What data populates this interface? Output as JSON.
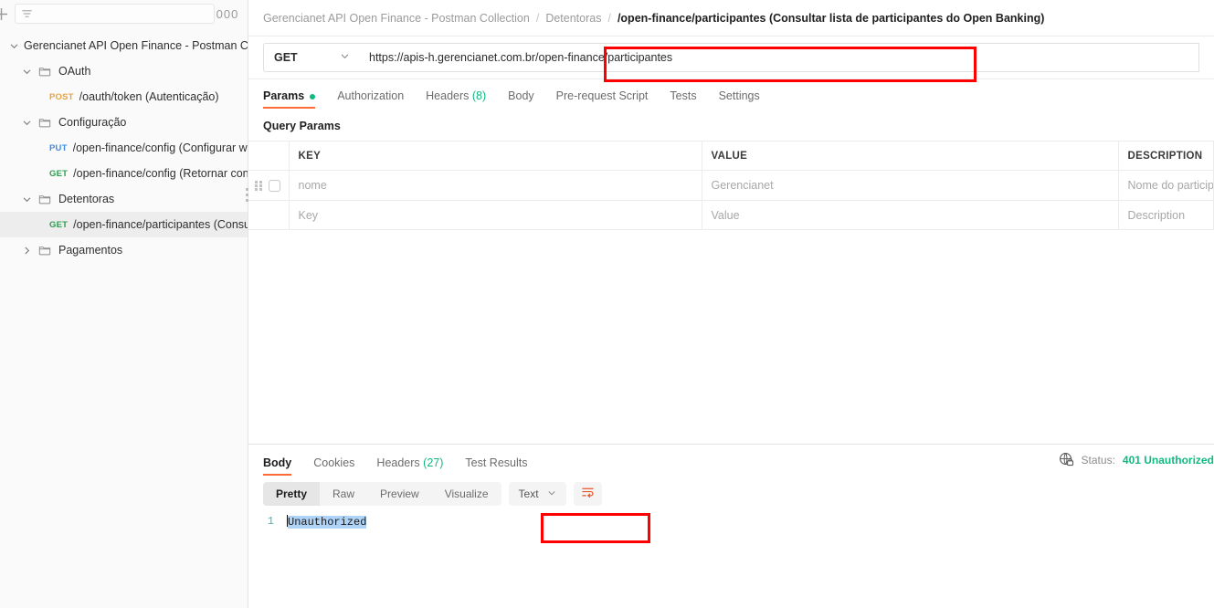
{
  "sidebar": {
    "add_icon": "plus-icon",
    "filter_icon": "filter-icon",
    "search_placeholder": "",
    "more_label": "000",
    "tree": [
      {
        "indent": 0,
        "type": "collection",
        "chevron": "down",
        "label": "Gerencianet API Open Finance - Postman Collection",
        "selected": false
      },
      {
        "indent": 1,
        "type": "folder",
        "chevron": "down",
        "label": "OAuth",
        "selected": false
      },
      {
        "indent": 2,
        "type": "request",
        "method": "POST",
        "label": "/oauth/token (Autenticação)",
        "selected": false
      },
      {
        "indent": 1,
        "type": "folder",
        "chevron": "down",
        "label": "Configuração",
        "selected": false
      },
      {
        "indent": 2,
        "type": "request",
        "method": "PUT",
        "label": "/open-finance/config (Configurar webhook)",
        "selected": false
      },
      {
        "indent": 2,
        "type": "request",
        "method": "GET",
        "label": "/open-finance/config (Retornar configuração)",
        "selected": false
      },
      {
        "indent": 1,
        "type": "folder",
        "chevron": "down",
        "label": "Detentoras",
        "selected": false
      },
      {
        "indent": 2,
        "type": "request",
        "method": "GET",
        "label": "/open-finance/participantes (Consultar lista)",
        "selected": true
      },
      {
        "indent": 1,
        "type": "folder",
        "chevron": "right",
        "label": "Pagamentos",
        "selected": false
      }
    ]
  },
  "breadcrumb": {
    "collection": "Gerencianet API Open Finance - Postman Collection",
    "folder": "Detentoras",
    "current": "/open-finance/participantes (Consultar lista de participantes do Open Banking)",
    "separator": "/"
  },
  "request": {
    "method": "GET",
    "url": "https://apis-h.gerencianet.com.br/open-finance/participantes",
    "tabs": [
      {
        "label": "Params",
        "badge": "dot",
        "active": true
      },
      {
        "label": "Authorization",
        "badge": "",
        "active": false
      },
      {
        "label": "Headers",
        "badge": "(8)",
        "active": false
      },
      {
        "label": "Body",
        "badge": "",
        "active": false
      },
      {
        "label": "Pre-request Script",
        "badge": "",
        "active": false
      },
      {
        "label": "Tests",
        "badge": "",
        "active": false
      },
      {
        "label": "Settings",
        "badge": "",
        "active": false
      }
    ],
    "query_params_title": "Query Params",
    "columns": [
      "KEY",
      "VALUE",
      "DESCRIPTION"
    ],
    "rows": [
      {
        "key": "nome",
        "value": "Gerencianet",
        "description": "Nome do participante",
        "has_grip": true
      },
      {
        "key": "Key",
        "value": "Value",
        "description": "Description",
        "has_grip": false
      }
    ]
  },
  "response": {
    "tabs": [
      {
        "label": "Body",
        "badge": "",
        "active": true
      },
      {
        "label": "Cookies",
        "badge": "",
        "active": false
      },
      {
        "label": "Headers",
        "badge": "(27)",
        "active": false
      },
      {
        "label": "Test Results",
        "badge": "",
        "active": false
      }
    ],
    "status_icon": "globe-lock-icon",
    "status_label": "Status:",
    "status_code": "401 Unauthorized",
    "view_tabs": [
      {
        "label": "Pretty",
        "active": true
      },
      {
        "label": "Raw",
        "active": false
      },
      {
        "label": "Preview",
        "active": false
      },
      {
        "label": "Visualize",
        "active": false
      }
    ],
    "format": "Text",
    "wrap_icon": "wrap-lines-icon",
    "body_line_number": "1",
    "body_text": "Unauthorized"
  },
  "colors": {
    "accent": "#ff6c37",
    "get": "#2a9d4e",
    "post": "#e8a33d",
    "put": "#3f8ae0",
    "success": "#10b981",
    "annotation": "#ff0000",
    "selection": "#aed3f7"
  }
}
